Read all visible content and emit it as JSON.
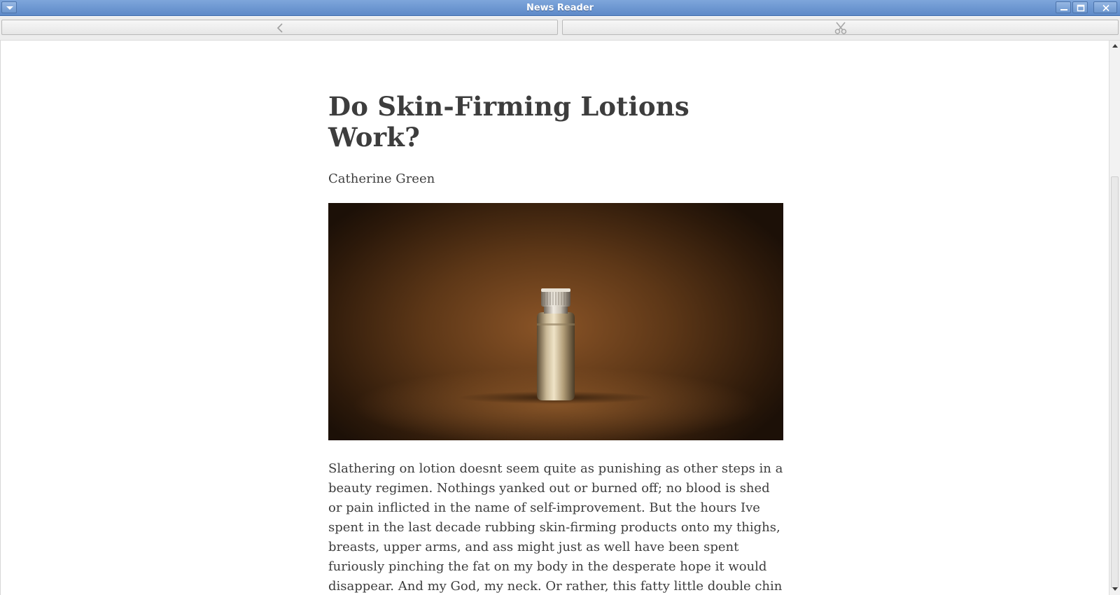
{
  "window": {
    "title": "News Reader"
  },
  "toolbar": {
    "back_icon": "chevron-left-icon",
    "clip_icon": "scissors-icon"
  },
  "article": {
    "title": "Do Skin-Firming Lotions Work?",
    "author": "Catherine Green",
    "image": "lotion-bottle-photo",
    "body": "Slathering on lotion doesnt seem quite as punishing as other steps in a beauty regimen. Nothings yanked out or burned off; no blood is shed or pain inflicted in the name of self-improvement. But the hours Ive spent in the last decade rubbing skin-firming products onto my thighs, breasts, upper arms, and ass might just as well have been spent furiously pinching the fat on my body in the desperate hope it would disappear. And my God, my neck. Or rather, this fatty little double chin hovering above it. Much as Ive brooded over the"
  },
  "colors": {
    "titlebar": "#6b95cf",
    "text": "#3d3d3d"
  }
}
